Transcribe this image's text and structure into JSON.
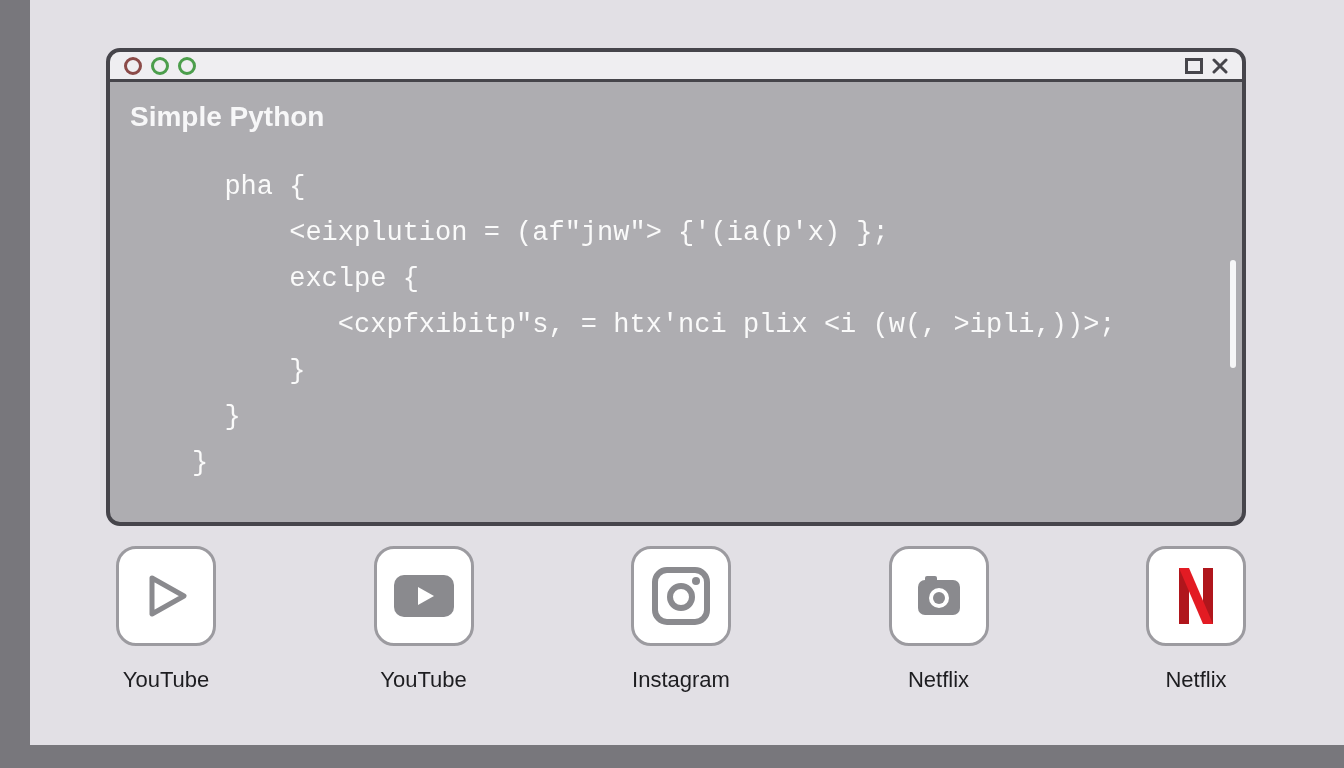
{
  "window": {
    "title": "Simple Python"
  },
  "code_lines": [
    "  pha {",
    "      <eixplution = (af\"jnw\"> {'(ia(p'x) };",
    "      exclpe {",
    "         <cxpfxibitp\"s, = htx'nci plix <i (w(, >ipli,))>;",
    "      }",
    "  }",
    "}"
  ],
  "apps": [
    {
      "label": "YouTube",
      "kind": "play"
    },
    {
      "label": "YouTube",
      "kind": "video"
    },
    {
      "label": "Instagram",
      "kind": "camera"
    },
    {
      "label": "Netflix",
      "kind": "lens"
    },
    {
      "label": "Netflix",
      "kind": "netflix"
    }
  ]
}
